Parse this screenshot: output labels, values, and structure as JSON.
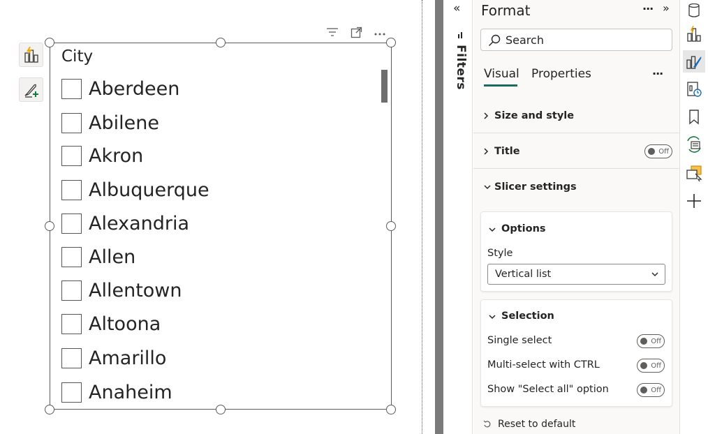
{
  "canvas": {
    "slicer": {
      "header": "City",
      "items": [
        "Aberdeen",
        "Abilene",
        "Akron",
        "Albuquerque",
        "Alexandria",
        "Allen",
        "Allentown",
        "Altoona",
        "Amarillo",
        "Anaheim"
      ],
      "toolbar": {
        "filter_icon": "filter-icon",
        "focus_icon": "focus-mode-icon",
        "more_icon": "more-options-icon"
      }
    },
    "side_buttons": [
      "build-visual-icon",
      "format-visual-icon"
    ]
  },
  "filters_pane": {
    "label": "Filters",
    "collapse_glyph": "«"
  },
  "format_pane": {
    "title": "Format",
    "more_glyph": "···",
    "expand_glyph": "»",
    "search_placeholder": "Search",
    "tabs": [
      {
        "label": "Visual",
        "active": true
      },
      {
        "label": "Properties",
        "active": false
      }
    ],
    "tabs_more": "···",
    "sections": [
      {
        "label": "Size and style",
        "expanded": false
      },
      {
        "label": "Title",
        "expanded": false,
        "toggle": "Off"
      },
      {
        "label": "Slicer settings",
        "expanded": true
      }
    ],
    "options_card": {
      "title": "Options",
      "style_label": "Style",
      "style_value": "Vertical list"
    },
    "selection_card": {
      "title": "Selection",
      "rows": [
        {
          "label": "Single select",
          "toggle": "Off"
        },
        {
          "label": "Multi-select with CTRL",
          "toggle": "Off"
        },
        {
          "label": "Show \"Select all\" option",
          "toggle": "Off"
        }
      ]
    },
    "reset_label": "Reset to default"
  },
  "rail": [
    "data-icon",
    "build-visual-icon",
    "format-visual-icon",
    "performance-analyzer-icon",
    "bookmark-icon",
    "sync-slicers-icon",
    "selection-icon",
    "add-icon"
  ],
  "colors": {
    "accent": "#1a6b5d",
    "splitter": "#7a7a7a",
    "pane_bg": "#faf9f8"
  }
}
